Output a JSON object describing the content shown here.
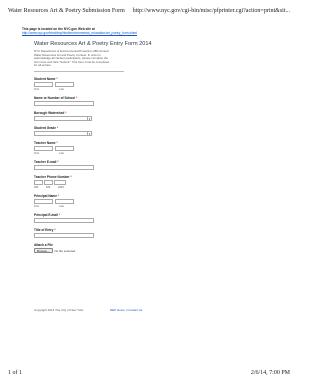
{
  "print_header": {
    "title": "Water Resources Art & Poetry Submission Form",
    "url": "http://www.nyc.gov/cgi-bin/misc/pfprinter.cgi?action=print&sit..."
  },
  "notice": {
    "text": "This page is located on the NYC.gov Web site at",
    "link": "http://www.nyc.gov/html/dep/html/environmental_education/art_poetry_form.shtml"
  },
  "form": {
    "title": "Water Resources Art & Poetry Entry Form 2014",
    "description": "NYC Department of Environmental Protection 28th Annual Water Resources Art and Poetry Contest. In order to acknowledge all student participants, please complete the form here and click \"Submit.\" This form must be completed for all entries.",
    "fields": {
      "student_name": {
        "label": "Student Name",
        "req": "*",
        "first": "First",
        "last": "Last"
      },
      "school": {
        "label": "Name or Number of School",
        "req": "*"
      },
      "borough": {
        "label": "Borough Watershed",
        "req": "*"
      },
      "grade": {
        "label": "Student Grade",
        "req": "*"
      },
      "teacher_name": {
        "label": "Teacher Name",
        "req": "*",
        "first": "First",
        "last": "Last"
      },
      "teacher_email": {
        "label": "Teacher E-mail",
        "req": "*"
      },
      "teacher_phone": {
        "label": "Teacher Phone Number",
        "req": "*",
        "p1": "###",
        "p2": "###",
        "p3": "####"
      },
      "principal_name": {
        "label": "Principal Name",
        "req": "*",
        "first": "First",
        "last": "Last"
      },
      "principal_email": {
        "label": "Principal E-mail",
        "req": "*"
      },
      "entry_title": {
        "label": "Title of Entry",
        "req": "*"
      },
      "attach": {
        "label": "Attach a File",
        "browse": "Browse...",
        "nofile": "No file selected."
      }
    }
  },
  "footer": {
    "copyright": "Copyright 2014  The City of New York",
    "links": [
      "DEP Home",
      "Contact Us"
    ],
    "separator": " | "
  },
  "print_footer": {
    "page": "1 of 1",
    "datetime": "2/6/14, 7:00 PM"
  },
  "icons": {
    "select_arrow": "chevron-down-icon"
  }
}
